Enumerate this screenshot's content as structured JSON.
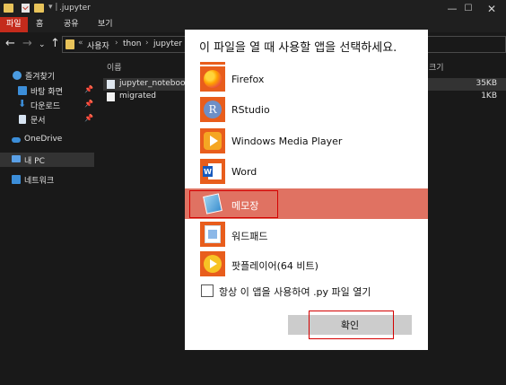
{
  "explorer": {
    "title": ".jupyter",
    "ribbon_tabs": [
      "파일",
      "홈",
      "공유",
      "보기"
    ],
    "window_controls": {
      "minimize": "—",
      "maximize": "☐",
      "close": "✕"
    },
    "breadcrumbs": [
      "사용자",
      "thon",
      "jupyter"
    ],
    "nav_icons": [
      "back-arrow-icon",
      "forward-arrow-icon",
      "recent-chevron-icon",
      "up-arrow-icon"
    ],
    "sidebar": [
      {
        "label": "즐겨찾기",
        "icon": "star-icon",
        "pinned": false
      },
      {
        "label": "바탕 화면",
        "icon": "desktop-icon",
        "pinned": true
      },
      {
        "label": "다운로드",
        "icon": "download-icon",
        "pinned": true
      },
      {
        "label": "문서",
        "icon": "document-icon",
        "pinned": true
      },
      {
        "label": "OneDrive",
        "icon": "cloud-icon",
        "pinned": false
      },
      {
        "label": "내 PC",
        "icon": "pc-icon",
        "pinned": false
      },
      {
        "label": "네트워크",
        "icon": "network-icon",
        "pinned": false
      }
    ],
    "columns": {
      "name": "이름",
      "size": "크기"
    },
    "files": [
      {
        "name": "jupyter_notebook_co",
        "size": "35KB"
      },
      {
        "name": "migrated",
        "size": "1KB"
      }
    ]
  },
  "dialog": {
    "title": "이 파일을 열 때 사용할 앱을 선택하세요.",
    "apps": [
      {
        "name": "Firefox",
        "icon": "firefox-icon"
      },
      {
        "name": "RStudio",
        "icon": "rstudio-icon"
      },
      {
        "name": "Windows Media Player",
        "icon": "media-player-icon"
      },
      {
        "name": "Word",
        "icon": "word-icon"
      },
      {
        "name": "메모장",
        "icon": "notepad-icon",
        "selected": true
      },
      {
        "name": "워드패드",
        "icon": "wordpad-icon"
      },
      {
        "name": "팟플레이어(64 비트)",
        "icon": "potplayer-icon"
      }
    ],
    "always_use_label": "항상 이 앱을 사용하여 .py 파일 열기",
    "always_use_checked": false,
    "ok_label": "확인"
  },
  "colors": {
    "explorer_bg": "#191919",
    "ribbon_active": "#c42b1c",
    "selected_app_bg": "#e07262",
    "highlight_box": "#d40000",
    "folder": "#e8c35a"
  }
}
